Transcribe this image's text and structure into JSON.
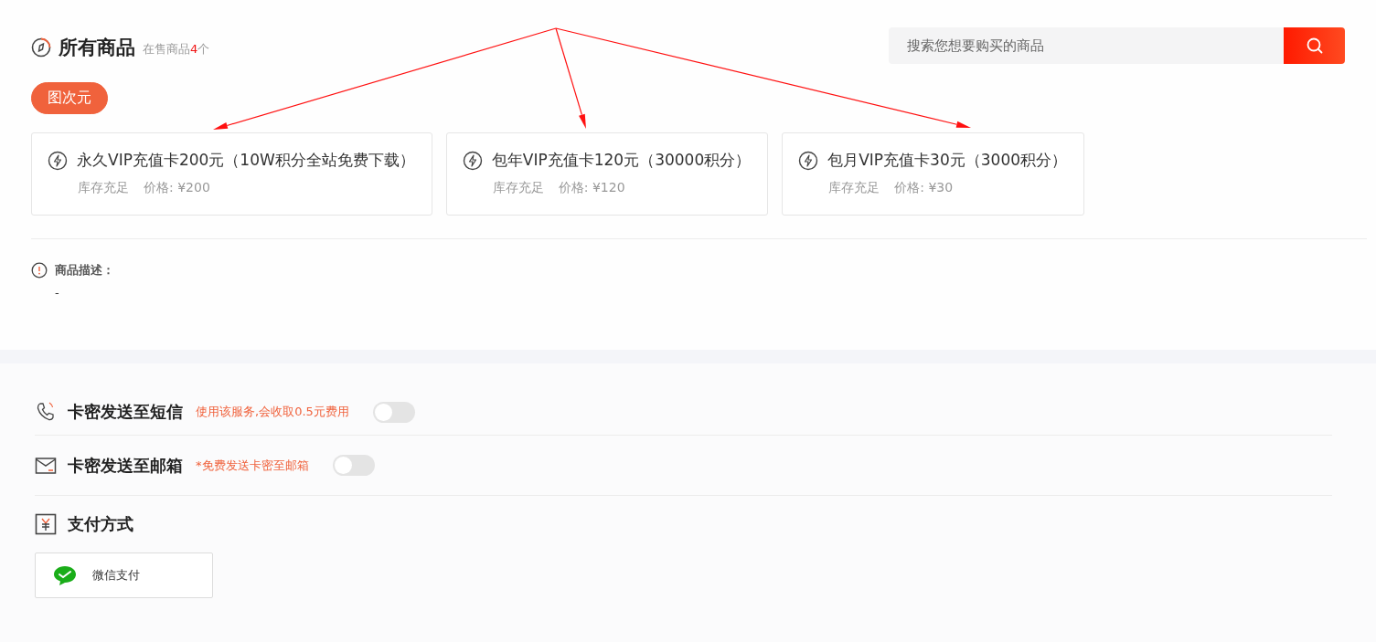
{
  "header": {
    "title": "所有商品",
    "count_before": "在售商品",
    "count": "4",
    "count_after": "个"
  },
  "search": {
    "placeholder": "搜索您想要购买的商品"
  },
  "categories": [
    {
      "label": "图次元",
      "selected": true
    }
  ],
  "products": [
    {
      "name": "永久VIP充值卡200元（10W积分全站免费下载）",
      "stock": "库存充足",
      "price": "价格: ¥200"
    },
    {
      "name": "包年VIP充值卡120元（30000积分）",
      "stock": "库存充足",
      "price": "价格: ¥120"
    },
    {
      "name": "包月VIP充值卡30元（3000积分）",
      "stock": "库存充足",
      "price": "价格: ¥30"
    }
  ],
  "description": {
    "label": "商品描述：",
    "text": "-"
  },
  "options": [
    {
      "kind": "sms",
      "title": "卡密发送至短信",
      "note": "使用该服务,会收取0.5元费用",
      "on": false
    },
    {
      "kind": "email",
      "title": "卡密发送至邮箱",
      "note": "*免费发送卡密至邮箱",
      "on": false
    }
  ],
  "payment": {
    "title": "支付方式",
    "methods": [
      {
        "label": "微信支付"
      }
    ]
  }
}
